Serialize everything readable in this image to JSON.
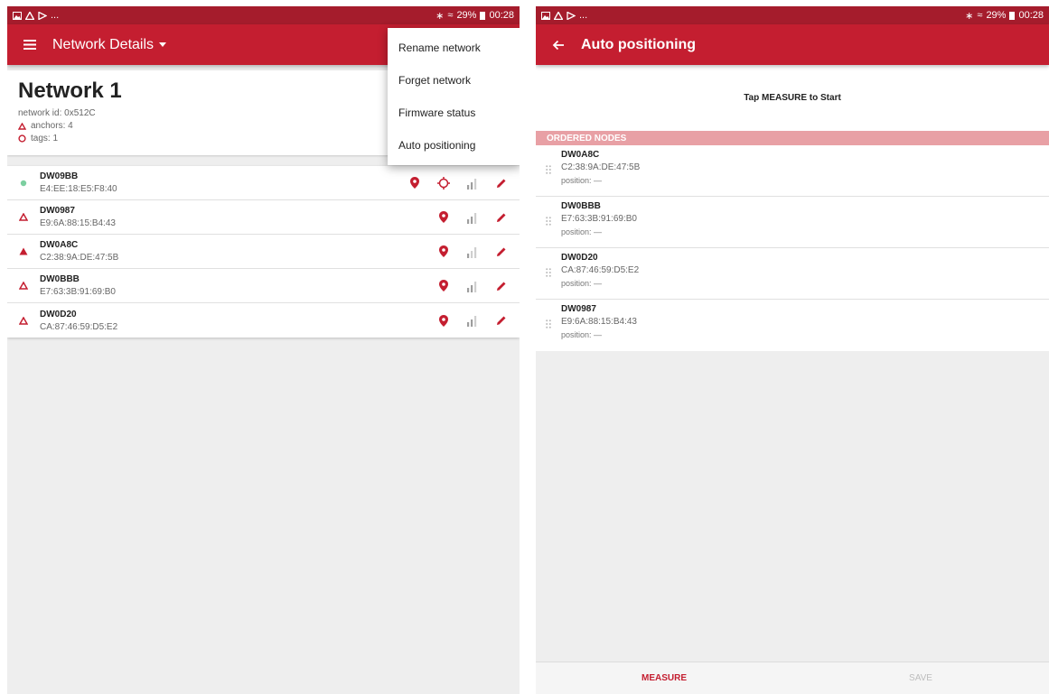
{
  "colors": {
    "primary": "#c41e30",
    "status_bar": "#a51c2c",
    "online_dot": "#7ccfa0",
    "accent_header": "#e8a0a5"
  },
  "status_bar": {
    "left_icons": [
      "image-icon",
      "drive-icon",
      "play-icon"
    ],
    "ellipsis": "...",
    "battery": "29%",
    "time": "00:28"
  },
  "left": {
    "appbar": {
      "title": "Network Details"
    },
    "network": {
      "name": "Network 1",
      "id_label": "network id: 0x512C",
      "anchors_label": "anchors: 4",
      "tags_label": "tags: 1"
    },
    "nodes": [
      {
        "name": "DW09BB",
        "address": "E4:EE:18:E5:F8:40",
        "kind": "tag"
      },
      {
        "name": "DW0987",
        "address": "E9:6A:88:15:B4:43",
        "kind": "anchor"
      },
      {
        "name": "DW0A8C",
        "address": "C2:38:9A:DE:47:5B",
        "kind": "anchor-initiator"
      },
      {
        "name": "DW0BBB",
        "address": "E7:63:3B:91:69:B0",
        "kind": "anchor"
      },
      {
        "name": "DW0D20",
        "address": "CA:87:46:59:D5:E2",
        "kind": "anchor"
      }
    ],
    "menu": {
      "items": [
        "Rename network",
        "Forget network",
        "Firmware status",
        "Auto positioning"
      ]
    }
  },
  "right": {
    "appbar": {
      "title": "Auto positioning"
    },
    "instruction": "Tap MEASURE to Start",
    "ordered_header": "ORDERED NODES",
    "ordered_nodes": [
      {
        "name": "DW0A8C",
        "address": "C2:38:9A:DE:47:5B",
        "position": "position: —"
      },
      {
        "name": "DW0BBB",
        "address": "E7:63:3B:91:69:B0",
        "position": "position: —"
      },
      {
        "name": "DW0D20",
        "address": "CA:87:46:59:D5:E2",
        "position": "position: —"
      },
      {
        "name": "DW0987",
        "address": "E9:6A:88:15:B4:43",
        "position": "position: —"
      }
    ],
    "buttons": {
      "measure": "MEASURE",
      "save": "SAVE"
    }
  }
}
